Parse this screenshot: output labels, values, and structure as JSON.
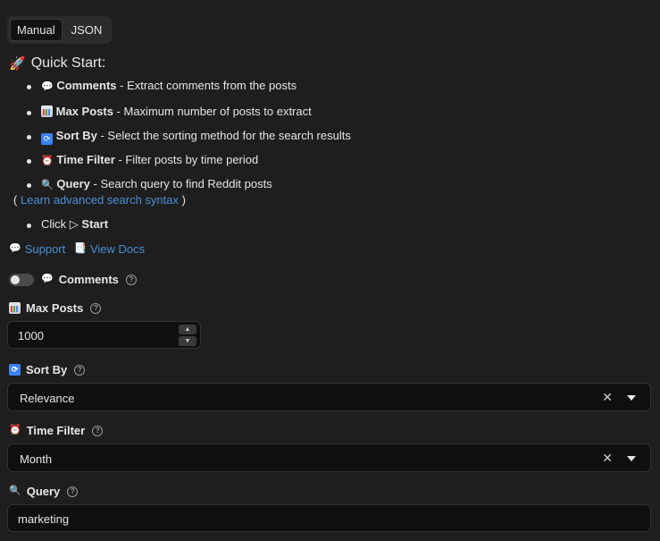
{
  "tabs": {
    "manual": "Manual",
    "json": "JSON"
  },
  "quick_start": {
    "icon": "🚀",
    "title": "Quick Start:",
    "items": [
      {
        "icon": "💬",
        "name": "Comments",
        "desc": " - Extract comments from the posts"
      },
      {
        "icon": "📊",
        "name": "Max Posts",
        "desc": " - Maximum number of posts to extract"
      },
      {
        "icon": "🔄",
        "name": "Sort By",
        "desc": " - Select the sorting method for the search results"
      },
      {
        "icon": "⏰",
        "name": "Time Filter",
        "desc": " - Filter posts by time period"
      },
      {
        "icon": "🔍",
        "name": "Query",
        "desc": " - Search query to find Reddit posts",
        "extra_open": "( ",
        "extra_link": "Learn advanced search syntax",
        "extra_close": " )"
      }
    ],
    "click": {
      "prefix": "Click ",
      "glyph": "▷",
      "action": "Start"
    }
  },
  "links": {
    "support": "Support",
    "view_docs": "View Docs"
  },
  "fields": {
    "comments": {
      "label": "Comments",
      "enabled": false
    },
    "max_posts": {
      "label": "Max Posts",
      "value": "1000"
    },
    "sort_by": {
      "label": "Sort By",
      "value": "Relevance"
    },
    "time_filter": {
      "label": "Time Filter",
      "value": "Month"
    },
    "query": {
      "label": "Query",
      "value": "marketing"
    }
  },
  "colors": {
    "background": "#1e1e1e",
    "link": "#4a8fd8",
    "input_bg": "#0f0f0f"
  }
}
